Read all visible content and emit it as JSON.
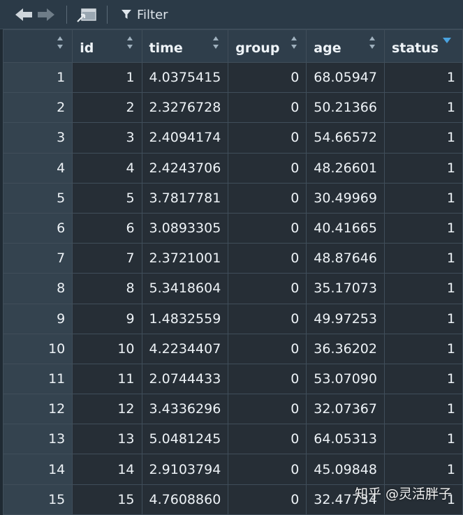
{
  "toolbar": {
    "filter_label": "Filter"
  },
  "columns": [
    {
      "key": "rownum",
      "label": ""
    },
    {
      "key": "id",
      "label": "id"
    },
    {
      "key": "time",
      "label": "time"
    },
    {
      "key": "group",
      "label": "group"
    },
    {
      "key": "age",
      "label": "age"
    },
    {
      "key": "status",
      "label": "status"
    }
  ],
  "sorted_column": "status",
  "sort_direction": "descending",
  "rows": [
    {
      "rownum": "1",
      "id": "1",
      "time": "4.0375415",
      "group": "0",
      "age": "68.05947",
      "status": "1"
    },
    {
      "rownum": "2",
      "id": "2",
      "time": "2.3276728",
      "group": "0",
      "age": "50.21366",
      "status": "1"
    },
    {
      "rownum": "3",
      "id": "3",
      "time": "2.4094174",
      "group": "0",
      "age": "54.66572",
      "status": "1"
    },
    {
      "rownum": "4",
      "id": "4",
      "time": "2.4243706",
      "group": "0",
      "age": "48.26601",
      "status": "1"
    },
    {
      "rownum": "5",
      "id": "5",
      "time": "3.7817781",
      "group": "0",
      "age": "30.49969",
      "status": "1"
    },
    {
      "rownum": "6",
      "id": "6",
      "time": "3.0893305",
      "group": "0",
      "age": "40.41665",
      "status": "1"
    },
    {
      "rownum": "7",
      "id": "7",
      "time": "2.3721001",
      "group": "0",
      "age": "48.87646",
      "status": "1"
    },
    {
      "rownum": "8",
      "id": "8",
      "time": "5.3418604",
      "group": "0",
      "age": "35.17073",
      "status": "1"
    },
    {
      "rownum": "9",
      "id": "9",
      "time": "1.4832559",
      "group": "0",
      "age": "49.97253",
      "status": "1"
    },
    {
      "rownum": "10",
      "id": "10",
      "time": "4.2234407",
      "group": "0",
      "age": "36.36202",
      "status": "1"
    },
    {
      "rownum": "11",
      "id": "11",
      "time": "2.0744433",
      "group": "0",
      "age": "53.07090",
      "status": "1"
    },
    {
      "rownum": "12",
      "id": "12",
      "time": "3.4336296",
      "group": "0",
      "age": "32.07367",
      "status": "1"
    },
    {
      "rownum": "13",
      "id": "13",
      "time": "5.0481245",
      "group": "0",
      "age": "64.05313",
      "status": "1"
    },
    {
      "rownum": "14",
      "id": "14",
      "time": "2.9103794",
      "group": "0",
      "age": "45.09848",
      "status": "1"
    },
    {
      "rownum": "15",
      "id": "15",
      "time": "4.7608860",
      "group": "0",
      "age": "32.47734",
      "status": "1"
    }
  ],
  "watermark": "知乎 @灵活胖子",
  "colors": {
    "toolbar_bg": "#2b3a47",
    "header_bg": "#2f3e4b",
    "rownum_bg": "#34434f",
    "cell_bg": "#262e36",
    "sort_accent": "#4aa3e0"
  },
  "icons": [
    "back-arrow-icon",
    "forward-arrow-icon",
    "popout-window-icon",
    "filter-funnel-icon",
    "sort-arrows-icon",
    "sort-descending-icon"
  ]
}
